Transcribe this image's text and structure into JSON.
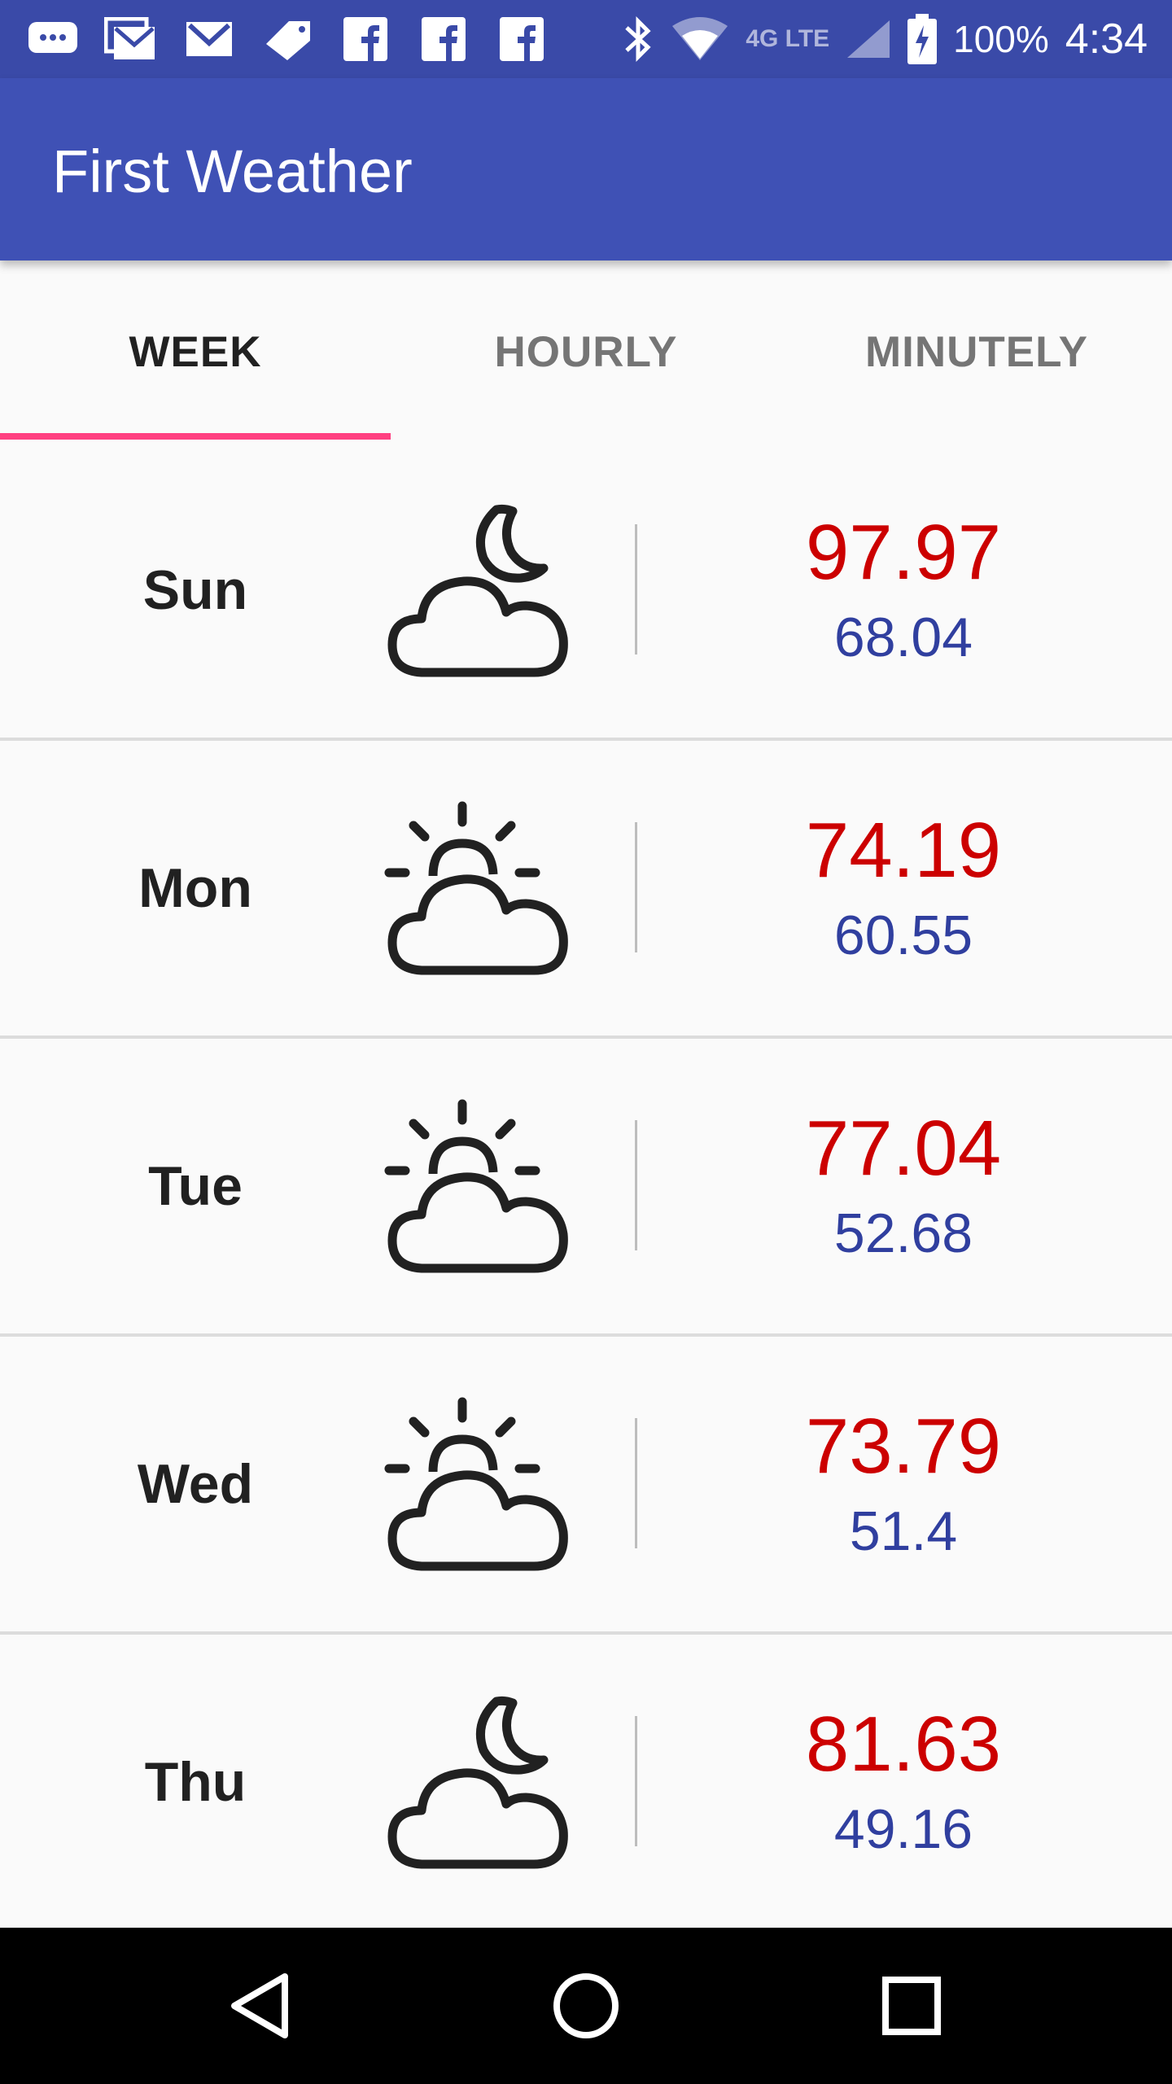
{
  "status_bar": {
    "battery": "100%",
    "time": "4:34",
    "network": "4G LTE"
  },
  "app": {
    "title": "First Weather"
  },
  "tabs": [
    {
      "label": "WEEK",
      "active": true
    },
    {
      "label": "HOURLY",
      "active": false
    },
    {
      "label": "MINUTELY",
      "active": false
    }
  ],
  "days": [
    {
      "day": "Sun",
      "icon": "cloudy-night-icon",
      "high": "97.97",
      "low": "68.04"
    },
    {
      "day": "Mon",
      "icon": "partly-cloudy-day-icon",
      "high": "74.19",
      "low": "60.55"
    },
    {
      "day": "Tue",
      "icon": "partly-cloudy-day-icon",
      "high": "77.04",
      "low": "52.68"
    },
    {
      "day": "Wed",
      "icon": "partly-cloudy-day-icon",
      "high": "73.79",
      "low": "51.4"
    },
    {
      "day": "Thu",
      "icon": "cloudy-night-icon",
      "high": "81.63",
      "low": "49.16"
    }
  ],
  "colors": {
    "app_bar": "#3f51b5",
    "status_bar": "#3a4aa8",
    "tab_indicator": "#ff4081",
    "high_temp": "#cc0000",
    "low_temp": "#303f9f"
  }
}
